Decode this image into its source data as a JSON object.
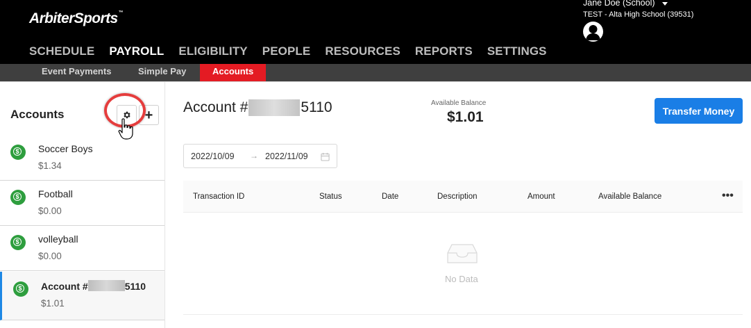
{
  "header": {
    "logo_part1": "Arbiter",
    "logo_part2": "Sports",
    "user_name": "Jane Doe (School)",
    "school": "TEST - Alta High School (39531)"
  },
  "main_nav": [
    "SCHEDULE",
    "PAYROLL",
    "ELIGIBILITY",
    "PEOPLE",
    "RESOURCES",
    "REPORTS",
    "SETTINGS"
  ],
  "main_nav_active": "PAYROLL",
  "sub_nav": {
    "event_payments": "Event Payments",
    "simple_pay": "Simple Pay",
    "accounts": "Accounts"
  },
  "sidebar": {
    "title": "Accounts",
    "add_symbol": "+",
    "accounts": [
      {
        "name": "Soccer Boys",
        "amount": "$1.34"
      },
      {
        "name": "Football",
        "amount": "$0.00"
      },
      {
        "name": "volleyball",
        "amount": "$0.00"
      },
      {
        "name_prefix": "Account #",
        "name_suffix": "5110",
        "amount": "$1.01"
      }
    ]
  },
  "main": {
    "account_prefix": "Account #",
    "account_suffix": "5110",
    "balance_label": "Available Balance",
    "balance_value": "$1.01",
    "transfer_button": "Transfer Money",
    "date_start": "2022/10/09",
    "date_arrow": "→",
    "date_end": "2022/11/09",
    "columns": [
      "Transaction ID",
      "Status",
      "Date",
      "Description",
      "Amount",
      "Available Balance"
    ],
    "more": "•••",
    "empty_text": "No Data"
  },
  "colors": {
    "brand_red": "#e41b23",
    "primary_blue": "#1a7ee6",
    "account_green": "#2e9e3e"
  }
}
